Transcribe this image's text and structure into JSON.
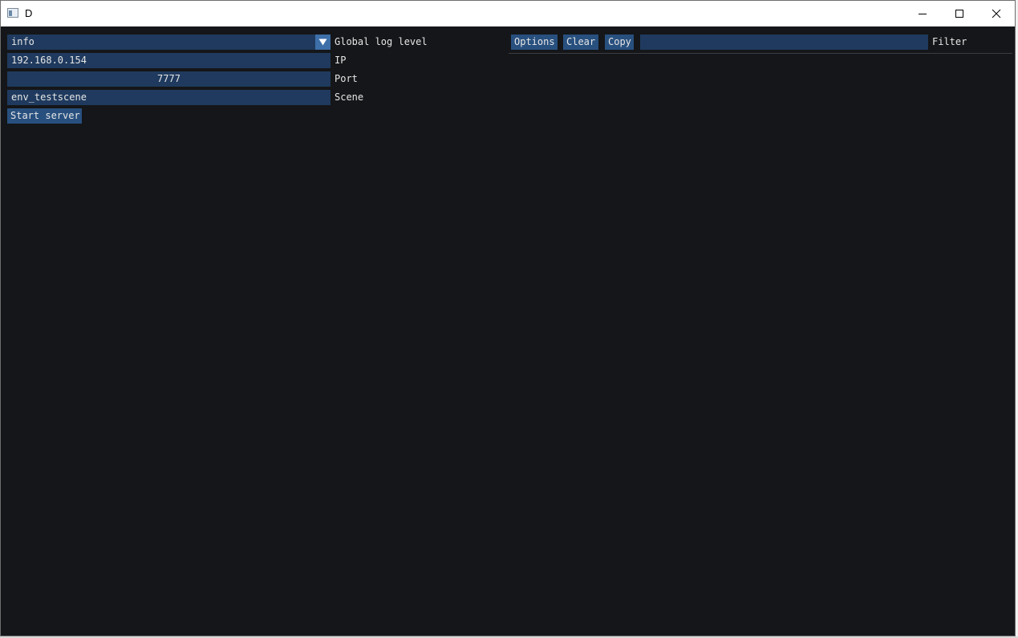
{
  "window": {
    "title": "D"
  },
  "left_panel": {
    "log_level": {
      "value": "info",
      "label": "Global log level"
    },
    "ip": {
      "value": "192.168.0.154",
      "label": "IP"
    },
    "port": {
      "value": "7777",
      "label": "Port"
    },
    "scene": {
      "value": "env_testscene",
      "label": "Scene"
    },
    "start_button": "Start server"
  },
  "log_panel": {
    "options_button": "Options",
    "clear_button": "Clear",
    "copy_button": "Copy",
    "filter": {
      "value": "",
      "label": "Filter"
    }
  },
  "icons": {
    "minimize": "minimize-icon",
    "maximize": "maximize-icon",
    "close": "close-icon",
    "combo": "triangle-down-icon"
  },
  "colors": {
    "background": "#151619",
    "field": "#1f3a5e",
    "button": "#28507f",
    "combo_arrow": "#3d6fa8",
    "text": "#e6e6e6"
  }
}
